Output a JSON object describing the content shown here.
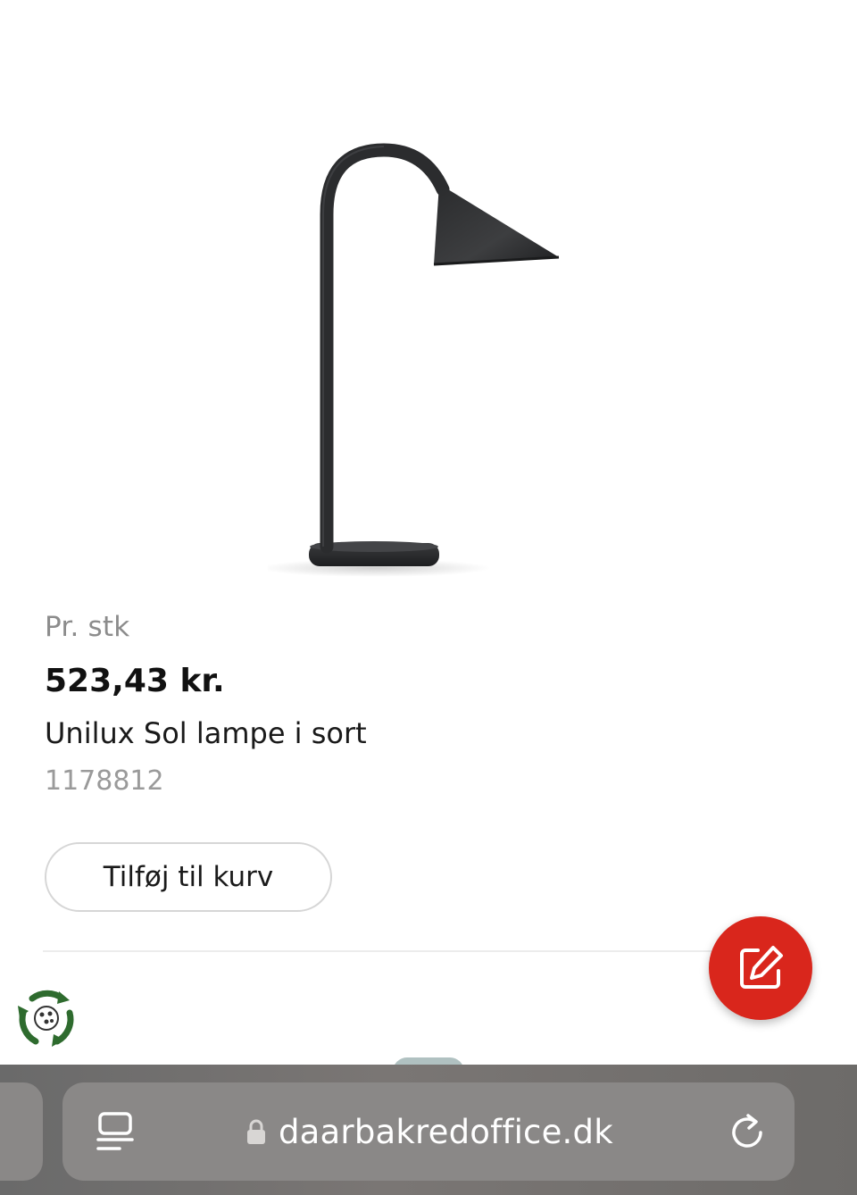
{
  "product": {
    "image_alt": "lamp",
    "unit_label": "Pr. stk",
    "price": "523,43 kr.",
    "name": "Unilux Sol lampe i sort",
    "number": "1178812",
    "add_to_cart_label": "Tilføj til kurv"
  },
  "fab": {
    "icon": "edit-icon",
    "color": "#d9261c"
  },
  "badge": {
    "icon": "recycle-eco-icon",
    "color": "#2e6b2e"
  },
  "browser": {
    "url": "daarbakredoffice.dk",
    "reader_icon": "reader-mode-icon",
    "lock_icon": "lock-icon",
    "reload_icon": "reload-icon"
  }
}
